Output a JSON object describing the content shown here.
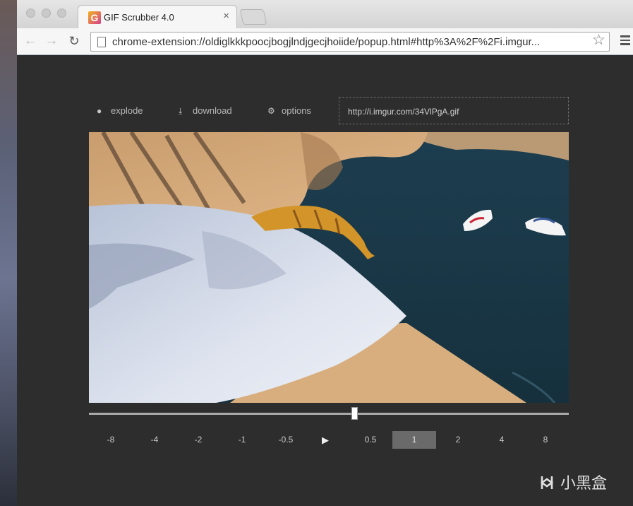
{
  "tab": {
    "title": "GIF Scrubber 4.0",
    "icon_letter": "G",
    "close": "×"
  },
  "toolbar": {
    "url": "chrome-extension://oldiglkkkpoocjbogjlndjgecjhoiide/popup.html#http%3A%2F%2Fi.imgur..."
  },
  "actions": {
    "explode": "explode",
    "download": "download",
    "options": "options",
    "gif_url": "http://i.imgur.com/34VlPgA.gif"
  },
  "scrubber": {
    "position": 0.55
  },
  "speeds": [
    "-8",
    "-4",
    "-2",
    "-1",
    "-0.5",
    "▶",
    "0.5",
    "1",
    "2",
    "4",
    "8"
  ],
  "active_speed": "1",
  "watermark": "小黑盒",
  "icons": {
    "explode": "bomb-icon",
    "download": "download-icon",
    "options": "gear-icon",
    "play": "play-icon"
  }
}
